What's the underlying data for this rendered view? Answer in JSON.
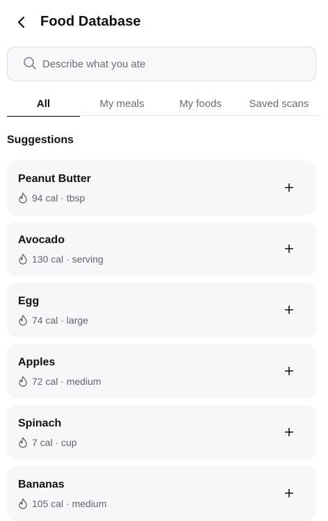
{
  "header": {
    "title": "Food Database",
    "back_icon": "chevron-left-icon"
  },
  "search": {
    "placeholder": "Describe what you ate",
    "value": "",
    "icon": "search-icon"
  },
  "tabs": [
    {
      "label": "All",
      "active": true
    },
    {
      "label": "My meals",
      "active": false
    },
    {
      "label": "My foods",
      "active": false
    },
    {
      "label": "Saved scans",
      "active": false
    }
  ],
  "suggestions": {
    "title": "Suggestions",
    "items": [
      {
        "name": "Peanut Butter",
        "meta": "94 cal · tbsp"
      },
      {
        "name": "Avocado",
        "meta": "130 cal · serving"
      },
      {
        "name": "Egg",
        "meta": "74 cal · large"
      },
      {
        "name": "Apples",
        "meta": "72 cal · medium"
      },
      {
        "name": "Spinach",
        "meta": "7 cal · cup"
      },
      {
        "name": "Bananas",
        "meta": "105 cal · medium"
      }
    ]
  },
  "colors": {
    "card_bg": "#f6f7f9",
    "text": "#111111",
    "muted": "#5f636b"
  }
}
